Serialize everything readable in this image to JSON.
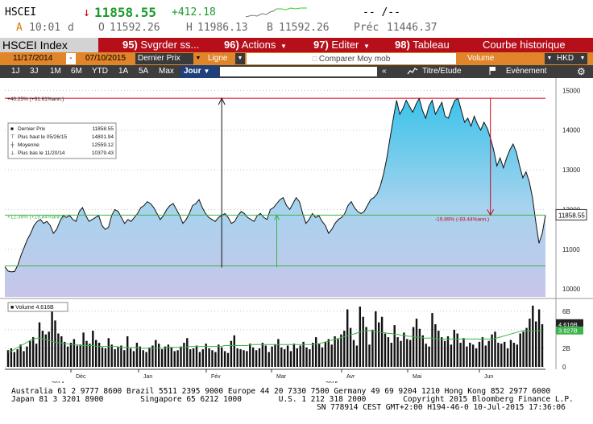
{
  "quote": {
    "ticker": "HSCEI",
    "arrow": "↓",
    "last": "11858.55",
    "change": "+412.18",
    "dash": "-- /--",
    "a_label": "A",
    "time": "10:01",
    "d_label": "d",
    "o_label": "O",
    "open": "11592.26",
    "h_label": "H",
    "high": "11986.13",
    "b_label": "B",
    "low": "11592.26",
    "prev_label": "Préc",
    "prev": "11446.37"
  },
  "menu": {
    "index_label": "HSCEI Index",
    "save_num": "95)",
    "save_label": "Svgrder ss...",
    "actions_num": "96)",
    "actions_label": "Actions",
    "edit_num": "97)",
    "edit_label": "Editer",
    "table_num": "98)",
    "table_label": "Tableau",
    "history_label": "Courbe historique"
  },
  "controls": {
    "start_date": "11/17/2014",
    "sep": "-",
    "end_date": "07/10/2015",
    "field": "Dernier Prix",
    "style": "Ligne",
    "compare": "Comparer Moy mob",
    "volume": "Volume",
    "currency": "HKD"
  },
  "periods": {
    "items": [
      "1J",
      "3J",
      "1M",
      "6M",
      "YTD",
      "1A",
      "5A",
      "Max"
    ],
    "frequency": "Jour",
    "arrows": "«",
    "title_study": "Titre/Etude",
    "event": "Evènement"
  },
  "colors": {
    "menu_red": "#b60f1a",
    "orange": "#e1852a",
    "line_green": "#3cb44b",
    "change_green": "#1a9a2a",
    "down_red": "#d0021b"
  },
  "chart_data": {
    "type": "area",
    "x_month_labels": [
      "Déc",
      "Jan",
      "Fév",
      "Mar",
      "Avr",
      "Mai",
      "Jun"
    ],
    "x_year_labels": [
      "2014",
      "2015"
    ],
    "y_ticks": [
      10000,
      11000,
      12000,
      13000,
      14000,
      15000
    ],
    "ylim": [
      9800,
      15150
    ],
    "y_values": [
      10560,
      10450,
      10430,
      10440,
      10600,
      10850,
      11050,
      11250,
      11400,
      11600,
      11700,
      11750,
      11650,
      11700,
      11600,
      11400,
      11500,
      11700,
      11850,
      11800,
      11850,
      11750,
      11700,
      11950,
      12050,
      11850,
      11700,
      11750,
      11800,
      11850,
      11600,
      11500,
      11550,
      11850,
      12000,
      11950,
      11800,
      11650,
      11750,
      11700,
      11800,
      11900,
      12050,
      12100,
      12200,
      12150,
      12050,
      11900,
      11750,
      11850,
      12000,
      12100,
      12150,
      12000,
      11850,
      11650,
      11750,
      11900,
      12100,
      12150,
      12250,
      12050,
      11900,
      11800,
      11750,
      11700,
      11800,
      11850,
      11900,
      11800,
      11650,
      11700,
      11850,
      11950,
      11900,
      11800,
      11750,
      11700,
      11850,
      11900,
      11800,
      11750,
      12000,
      12050,
      12150,
      12250,
      12300,
      12100,
      12000,
      12150,
      12300,
      12200,
      11900,
      11650,
      11750,
      11900,
      11800,
      11850,
      11700,
      11600,
      11400,
      11500,
      11650,
      11750,
      11800,
      11900,
      12100,
      12200,
      12050,
      11950,
      11900,
      11950,
      12100,
      12250,
      12300,
      12400,
      12600,
      12900,
      13300,
      13800,
      14300,
      14750,
      14400,
      14550,
      14750,
      14600,
      14450,
      14650,
      14800,
      14500,
      14300,
      14600,
      14750,
      14400,
      14550,
      14700,
      14350,
      14300,
      14550,
      14750,
      14800,
      14500,
      14200,
      14300,
      14100,
      14350,
      14150,
      14000,
      14200,
      14050,
      13800,
      13500,
      13100,
      13300,
      13050,
      13300,
      13500,
      13650,
      13450,
      13100,
      12800,
      12950,
      12700,
      12300,
      11700,
      11150,
      11400,
      11858.55
    ],
    "last_price_label": "11858.55",
    "legend_title": "Dernier Prix",
    "legend": [
      {
        "label": "Dernier Prix",
        "value": "11858.55"
      },
      {
        "label": "Plus haut le 05/26/15",
        "value": "14801.94"
      },
      {
        "label": "Moyenne",
        "value": "12559.12"
      },
      {
        "label": "Plus bas le 11/20/14",
        "value": "10379.43"
      }
    ],
    "annotations": {
      "top_pct": "+40.25% (+91.61%ann.)",
      "mid_pct": "+12.36% (+19.84%ann.)",
      "down_pct": "-19.89% (-83.44%ann.)"
    },
    "high_line": 14801.94,
    "low_line": 10580,
    "mid_line": 11860,
    "volume": {
      "label": "Volume 4.616B",
      "last_label": "4.616B",
      "avg_label": "3.927B",
      "y_ticks": [
        "0",
        "2B",
        "4B",
        "6B"
      ],
      "ymax": 7.2,
      "values": [
        1.8,
        2.0,
        1.6,
        1.9,
        2.4,
        1.7,
        2.2,
        2.8,
        3.2,
        2.5,
        4.8,
        3.9,
        3.5,
        3.8,
        6.1,
        5.0,
        3.6,
        3.3,
        2.7,
        2.2,
        2.6,
        3.0,
        2.3,
        2.4,
        3.7,
        2.8,
        2.5,
        3.9,
        2.9,
        2.6,
        2.1,
        2.0,
        3.1,
        2.4,
        1.9,
        2.2,
        2.3,
        1.8,
        3.3,
        2.0,
        1.7,
        2.6,
        2.2,
        1.8,
        1.6,
        2.1,
        2.3,
        2.9,
        2.5,
        1.9,
        2.2,
        2.4,
        2.1,
        1.7,
        1.8,
        2.2,
        2.6,
        3.1,
        1.9,
        2.0,
        2.3,
        1.6,
        1.9,
        2.5,
        2.0,
        1.8,
        1.6,
        2.4,
        2.1,
        1.7,
        1.5,
        2.8,
        3.4,
        2.0,
        1.9,
        1.8,
        1.7,
        2.5,
        2.1,
        1.8,
        2.0,
        2.6,
        2.3,
        1.6,
        2.2,
        2.4,
        3.0,
        2.1,
        1.9,
        2.3,
        1.7,
        2.5,
        2.0,
        2.3,
        2.7,
        2.1,
        1.9,
        2.6,
        3.2,
        2.5,
        2.1,
        2.7,
        3.0,
        2.4,
        3.3,
        3.0,
        3.5,
        3.9,
        6.2,
        4.2,
        2.9,
        2.3,
        6.5,
        5.4,
        4.3,
        2.4,
        4.0,
        6.0,
        4.8,
        5.4,
        3.6,
        3.2,
        2.6,
        4.5,
        3.2,
        2.8,
        3.7,
        3.0,
        2.9,
        4.3,
        5.2,
        4.1,
        3.4,
        2.5,
        2.2,
        5.8,
        4.6,
        3.9,
        3.2,
        2.8,
        3.3,
        2.4,
        4.0,
        3.6,
        2.6,
        3.1,
        2.2,
        2.6,
        2.4,
        2.0,
        2.7,
        3.2,
        2.3,
        2.8,
        3.5,
        3.8,
        2.6,
        2.5,
        2.7,
        2.0,
        2.9,
        2.6,
        2.4,
        3.6,
        3.8,
        4.2,
        5.2,
        6.6,
        4.9,
        6.2,
        4.6
      ],
      "avg": [
        1.6,
        1.7,
        1.9,
        2.1,
        2.3,
        2.5,
        2.7,
        2.9,
        3.0,
        3.1,
        3.1,
        3.0,
        2.9,
        2.8,
        2.7,
        2.6,
        2.6,
        2.5,
        2.5,
        2.4,
        2.4,
        2.4,
        2.3,
        2.3,
        2.3,
        2.3,
        2.3,
        2.2,
        2.2,
        2.2,
        2.2,
        2.2,
        2.2,
        2.2,
        2.1,
        2.1,
        2.1,
        2.1,
        2.1,
        2.1,
        2.0,
        2.0,
        2.0,
        2.0,
        2.0,
        2.0,
        2.0,
        2.0,
        2.0,
        2.1,
        2.1,
        2.1,
        2.1,
        2.1,
        2.1,
        2.2,
        2.2,
        2.2,
        2.2,
        2.2,
        2.2,
        2.2,
        2.2,
        2.2,
        2.2,
        2.2,
        2.3,
        2.3,
        2.3,
        2.3,
        2.3,
        2.3,
        2.3,
        2.3,
        2.4,
        2.4,
        2.4,
        2.4,
        2.4,
        2.4,
        2.4,
        2.4,
        2.4,
        2.4,
        2.4,
        2.4,
        2.4,
        2.4,
        2.4,
        2.4,
        2.4,
        2.4,
        2.4,
        2.4,
        2.5,
        2.5,
        2.6,
        2.7,
        2.8,
        2.9,
        3.0,
        3.1,
        3.2,
        3.3,
        3.4,
        3.5,
        3.6,
        3.7,
        3.8,
        3.9,
        3.9,
        3.9,
        3.8,
        3.8,
        3.7,
        3.7,
        3.6,
        3.6,
        3.5,
        3.5,
        3.4,
        3.4,
        3.3,
        3.3,
        3.2,
        3.2,
        3.2,
        3.1,
        3.1,
        3.1,
        3.1,
        3.0,
        3.0,
        3.0,
        3.0,
        3.0,
        3.0,
        3.0,
        3.0,
        3.0,
        3.0,
        3.0,
        3.0,
        3.0,
        3.0,
        3.0,
        3.0,
        3.0,
        3.0,
        3.1,
        3.2,
        3.3,
        3.4,
        3.5,
        3.6,
        3.7,
        3.8,
        3.9,
        3.9,
        3.9,
        3.9,
        3.9,
        3.9,
        3.9
      ]
    }
  },
  "footer": {
    "line1": "Australia 61 2 9777 8600 Brazil 5511 2395 9000 Europe 44 20 7330 7500 Germany 49 69 9204 1210 Hong Kong 852 2977 6000",
    "line2": "Japan 81 3 3201 8900        Singapore 65 6212 1000        U.S. 1 212 318 2000        Copyright 2015 Bloomberg Finance L.P.",
    "line3": "SN 778914 CEST GMT+2:00 H194-46-0 10-Jul-2015 17:36:06"
  }
}
